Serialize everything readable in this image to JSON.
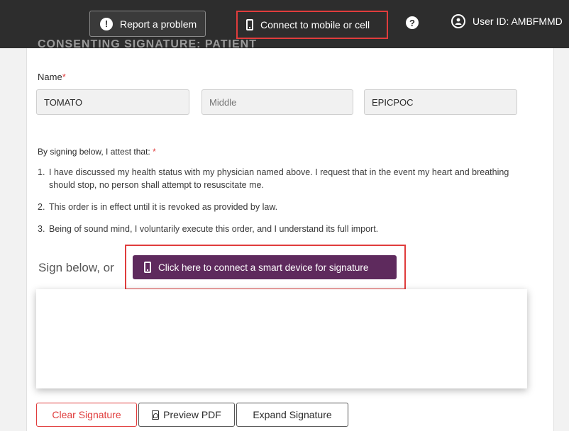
{
  "topbar": {
    "report_label": "Report a problem",
    "mobile_label": "Connect to mobile or cell",
    "help_symbol": "?",
    "report_symbol": "!",
    "user_label": "User ID: AMBFMMD"
  },
  "form": {
    "section_heading": "CONSENTING SIGNATURE: PATIENT",
    "name_label": "Name",
    "required_mark": "*",
    "first_name": "TOMATO",
    "middle_placeholder": "Middle",
    "last_name": "EPICPOC",
    "attest_label": "By signing below, I attest that:",
    "attest_items": [
      {
        "num": "1.",
        "text": "I have discussed my health status with my physician named above. I request that in the event my heart and breathing should stop, no person shall attempt to resuscitate me."
      },
      {
        "num": "2.",
        "text": "This order is in effect until it is revoked as provided by law."
      },
      {
        "num": "3.",
        "text": "Being of sound mind, I voluntarily execute this order, and I understand its full import."
      }
    ],
    "sign_prompt": "Sign below, or",
    "connect_device_label": "Click here to connect a smart device for signature",
    "clear_label": "Clear Signature",
    "preview_label": "Preview PDF",
    "expand_label": "Expand Signature"
  },
  "colors": {
    "topbar": "#2d2d2d",
    "accent_purple": "#5e2a5d",
    "highlight_red": "#e03c3c"
  }
}
